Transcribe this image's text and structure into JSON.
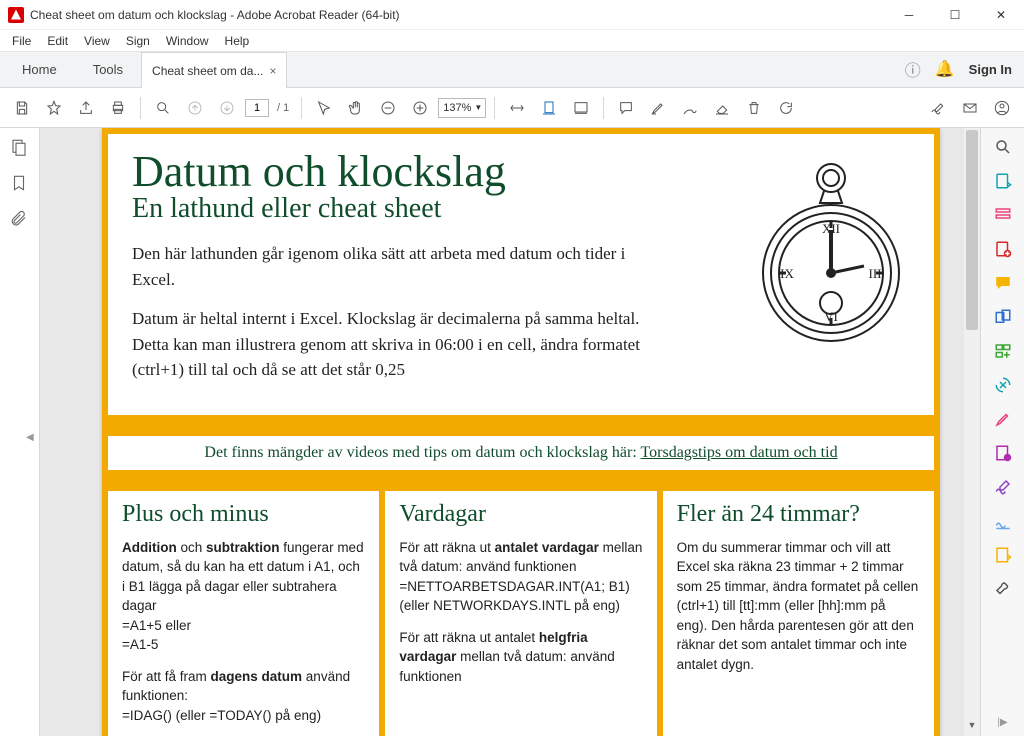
{
  "window": {
    "title": "Cheat sheet om datum och klockslag - Adobe Acrobat Reader (64-bit)"
  },
  "menu": {
    "file": "File",
    "edit": "Edit",
    "view": "View",
    "sign": "Sign",
    "window": "Window",
    "help": "Help"
  },
  "tabs": {
    "home": "Home",
    "tools": "Tools",
    "doc": "Cheat sheet om da...",
    "close": "×"
  },
  "topright": {
    "signin": "Sign In"
  },
  "toolbar": {
    "page": "1",
    "page_total": "/ 1",
    "zoom": "137%"
  },
  "doc": {
    "title": "Datum och klockslag",
    "subtitle": "En lathund eller cheat sheet",
    "intro1": "Den här lathunden går igenom olika sätt att arbeta med datum och tider i Excel.",
    "intro2": "Datum är heltal internt i Excel. Klockslag är decimalerna på samma heltal. Detta kan man illustrera genom att skriva in 06:00 i en cell, ändra formatet (ctrl+1) till tal och då se att det står 0,25",
    "tip_pre": "Det finns mängder av videos med tips om datum och klockslag här: ",
    "tip_link": "Torsdagstips om datum och tid",
    "col1": {
      "title": "Plus och minus",
      "p1a": "Addition",
      "p1b": " och ",
      "p1c": "subtraktion",
      "p1d": " fungerar med datum, så du kan ha ett datum i A1, och i B1 lägga på dagar eller subtrahera dagar",
      "p1e": "=A1+5 eller",
      "p1f": "=A1-5",
      "p2a": "För att få fram ",
      "p2b": "dagens datum",
      "p2c": " använd funktionen:",
      "p2d": "=IDAG() (eller =TODAY() på eng)"
    },
    "col2": {
      "title": "Vardagar",
      "p1a": "För att räkna ut ",
      "p1b": "antalet vardagar",
      "p1c": " mellan två datum: använd funktionen",
      "p1d": "=NETTOARBETSDAGAR.INT(A1; B1) (eller NETWORKDAYS.INTL på eng)",
      "p2a": "För att räkna ut antalet ",
      "p2b": "helgfria vardagar",
      "p2c": " mellan två datum: använd funktionen"
    },
    "col3": {
      "title": "Fler än 24 timmar?",
      "p1": "Om du summerar timmar och vill att Excel ska räkna 23 timmar + 2 timmar som 25 timmar, ändra formatet på cellen (ctrl+1) till [tt]:mm (eller [hh]:mm på eng). Den hårda parentesen gör att den räknar det som antalet timmar och inte antalet dygn."
    }
  }
}
